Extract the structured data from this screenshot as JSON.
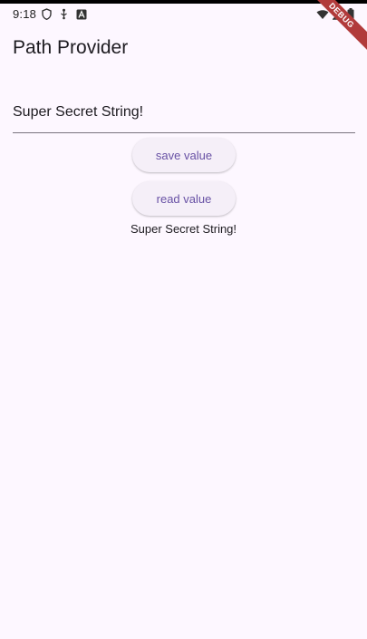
{
  "status_bar": {
    "time": "9:18",
    "left_icons": [
      "shield-icon",
      "usb-icon",
      "a-icon"
    ],
    "right_icons": [
      "wifi-icon",
      "signal-icon",
      "battery-icon"
    ]
  },
  "debug_banner": {
    "label": "DEBUG"
  },
  "app_bar": {
    "title": "Path Provider"
  },
  "text_field": {
    "value": "Super Secret String!"
  },
  "buttons": {
    "save_label": "save value",
    "read_label": "read value"
  },
  "result": {
    "text": "Super Secret String!"
  },
  "colors": {
    "background": "#fdf7ff",
    "accent": "#6750a4",
    "button_bg": "#f5eff8",
    "debug_banner": "#b13b3b"
  }
}
